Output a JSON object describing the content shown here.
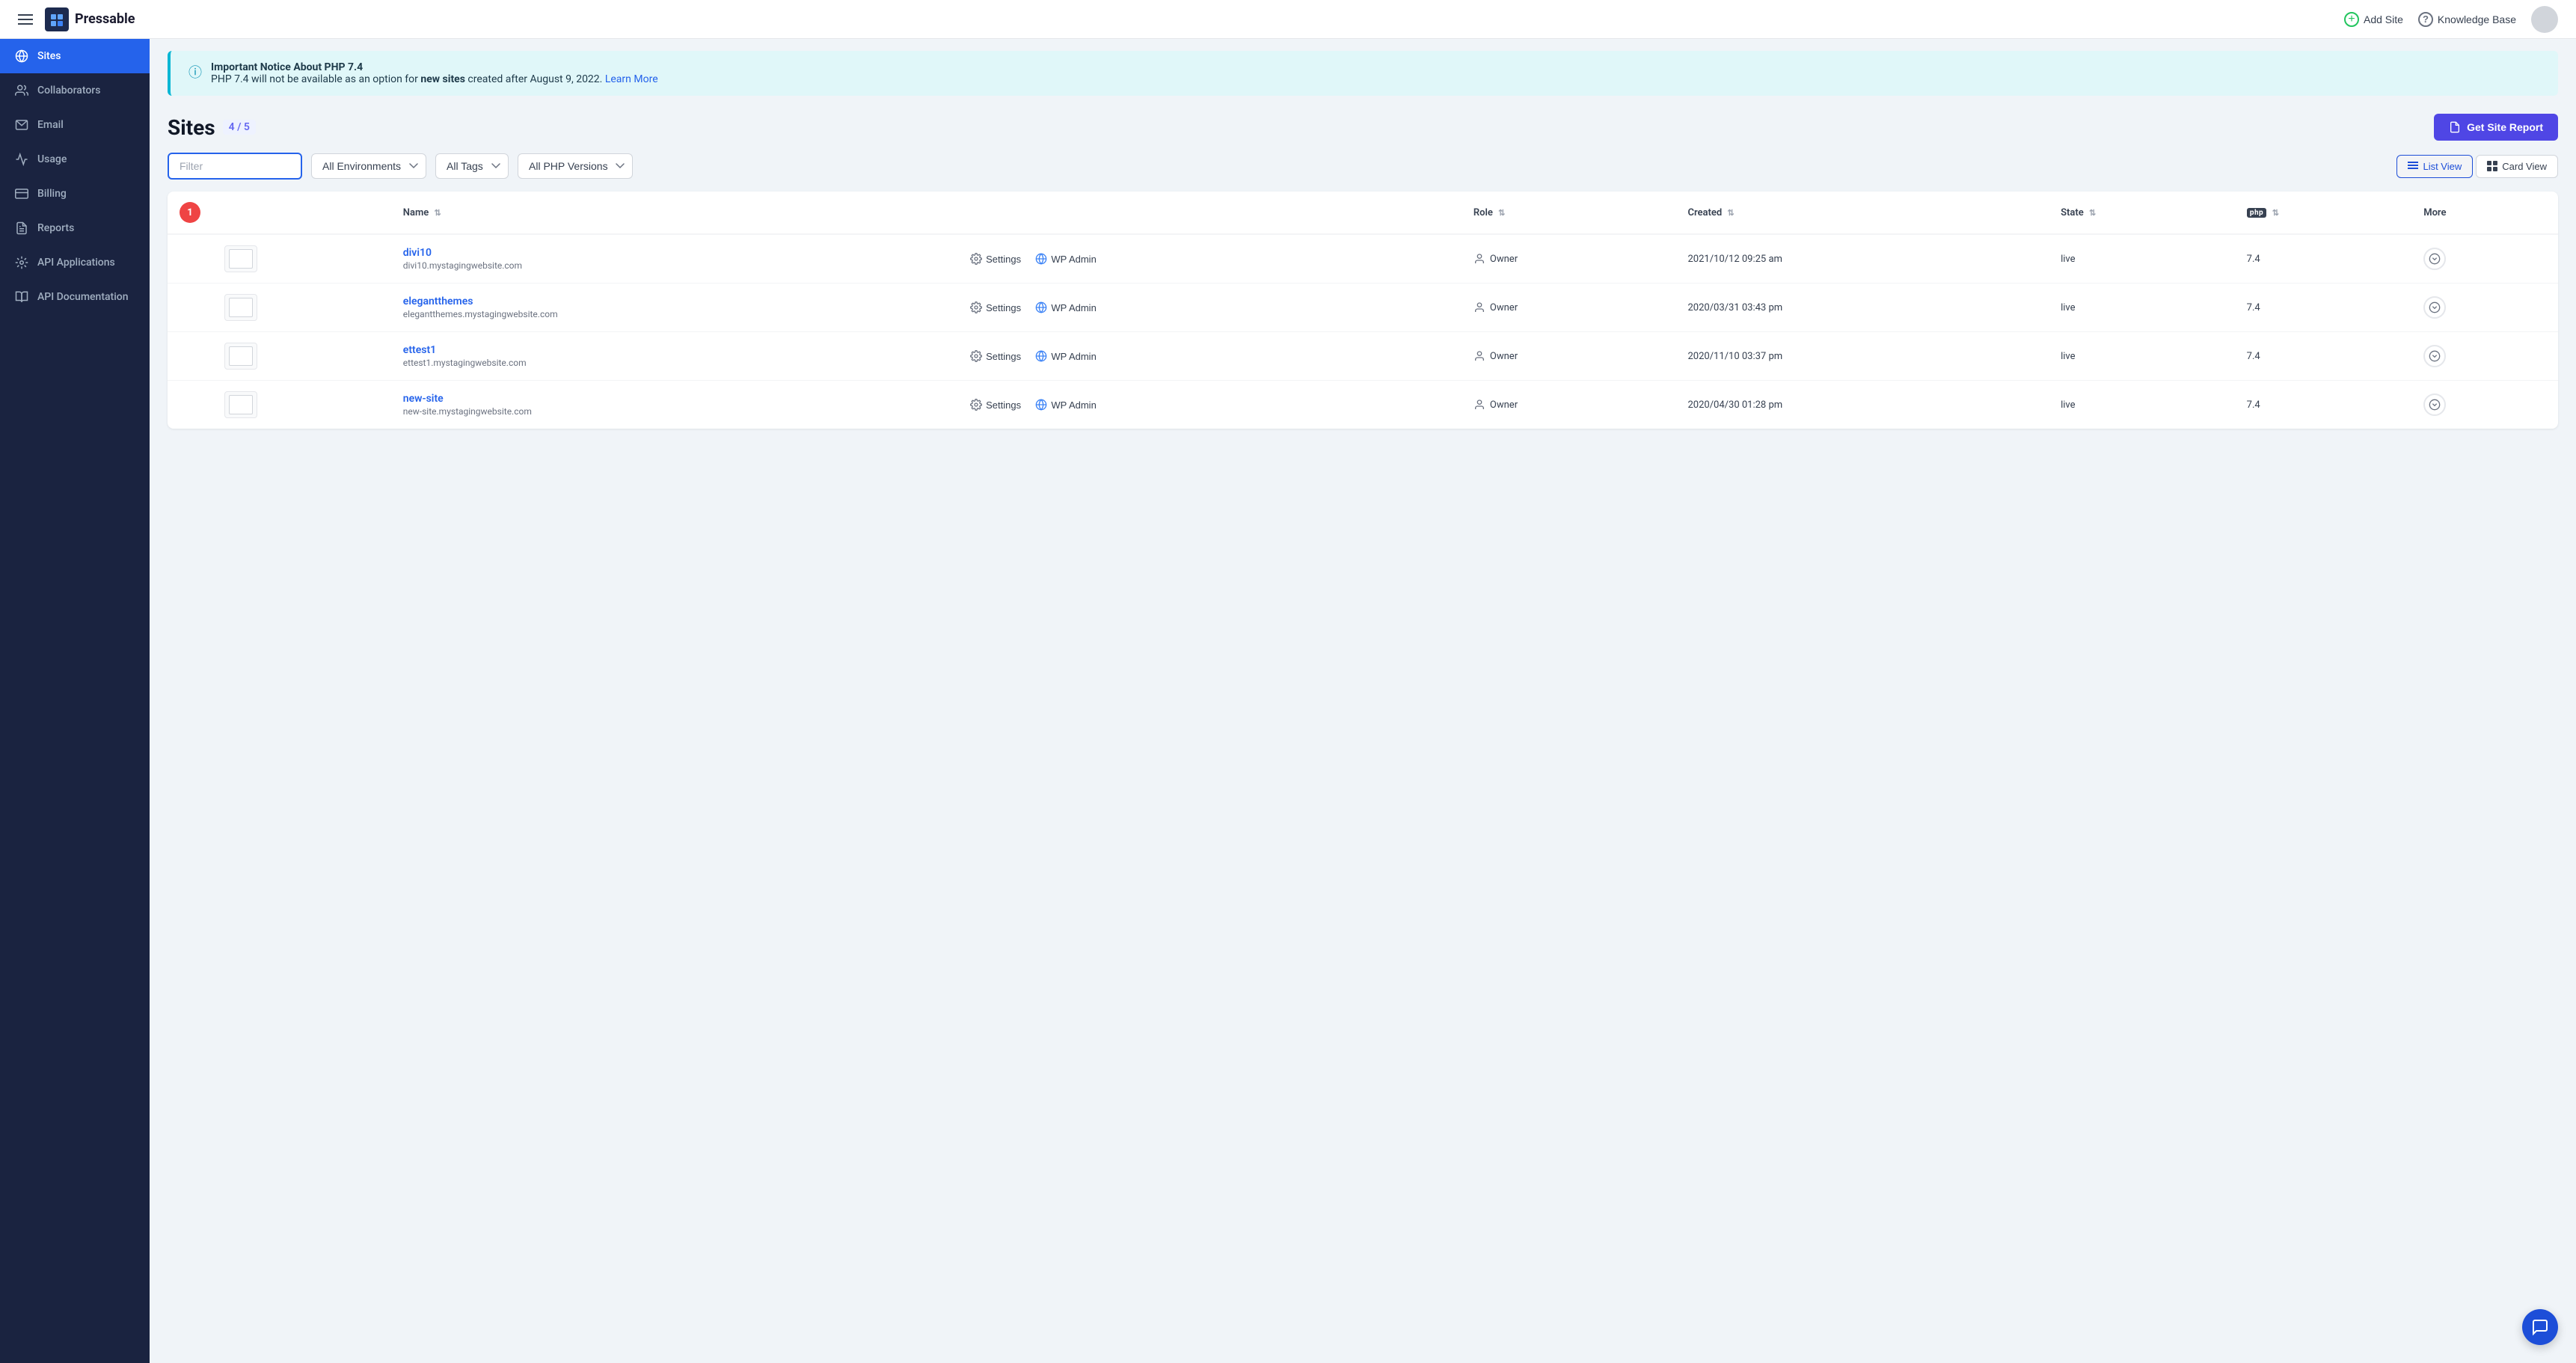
{
  "header": {
    "menu_icon": "menu-icon",
    "brand_name": "Pressable",
    "add_site_label": "Add Site",
    "knowledge_base_label": "Knowledge Base"
  },
  "sidebar": {
    "items": [
      {
        "id": "sites",
        "label": "Sites",
        "icon": "wordpress-icon",
        "active": true
      },
      {
        "id": "collaborators",
        "label": "Collaborators",
        "icon": "collaborators-icon",
        "active": false
      },
      {
        "id": "email",
        "label": "Email",
        "icon": "email-icon",
        "active": false
      },
      {
        "id": "usage",
        "label": "Usage",
        "icon": "usage-icon",
        "active": false
      },
      {
        "id": "billing",
        "label": "Billing",
        "icon": "billing-icon",
        "active": false
      },
      {
        "id": "reports",
        "label": "Reports",
        "icon": "reports-icon",
        "active": false
      },
      {
        "id": "api-applications",
        "label": "API Applications",
        "icon": "api-icon",
        "active": false
      },
      {
        "id": "api-documentation",
        "label": "API Documentation",
        "icon": "doc-icon",
        "active": false
      }
    ]
  },
  "notice": {
    "title": "Important Notice About PHP 7.4",
    "text_before": "PHP 7.4 will not be available as an option for ",
    "bold_text": "new sites",
    "text_after": " created after August 9, 2022.",
    "link_text": "Learn More",
    "link_href": "#"
  },
  "sites_section": {
    "title": "Sites",
    "count": "4 / 5",
    "get_report_label": "Get Site Report",
    "filter_placeholder": "Filter",
    "filter_env_label": "All Environments",
    "filter_tags_label": "All Tags",
    "filter_php_label": "All PHP Versions",
    "list_view_label": "List View",
    "card_view_label": "Card View"
  },
  "table": {
    "columns": {
      "name": "Name",
      "role": "Role",
      "created": "Created",
      "state": "State",
      "php": "PHP",
      "more": "More"
    },
    "rows": [
      {
        "id": 1,
        "name": "divi10",
        "domain": "divi10.mystagingwebsite.com",
        "role": "Owner",
        "created": "2021/10/12 09:25 am",
        "state": "live",
        "php": "7.4"
      },
      {
        "id": 2,
        "name": "elegantthemes",
        "domain": "elegantthemes.mystagingwebsite.com",
        "role": "Owner",
        "created": "2020/03/31 03:43 pm",
        "state": "live",
        "php": "7.4"
      },
      {
        "id": 3,
        "name": "ettest1",
        "domain": "ettest1.mystagingwebsite.com",
        "role": "Owner",
        "created": "2020/11/10 03:37 pm",
        "state": "live",
        "php": "7.4"
      },
      {
        "id": 4,
        "name": "new-site",
        "domain": "new-site.mystagingwebsite.com",
        "role": "Owner",
        "created": "2020/04/30 01:28 pm",
        "state": "live",
        "php": "7.4"
      }
    ],
    "settings_label": "Settings",
    "wp_admin_label": "WP Admin"
  }
}
